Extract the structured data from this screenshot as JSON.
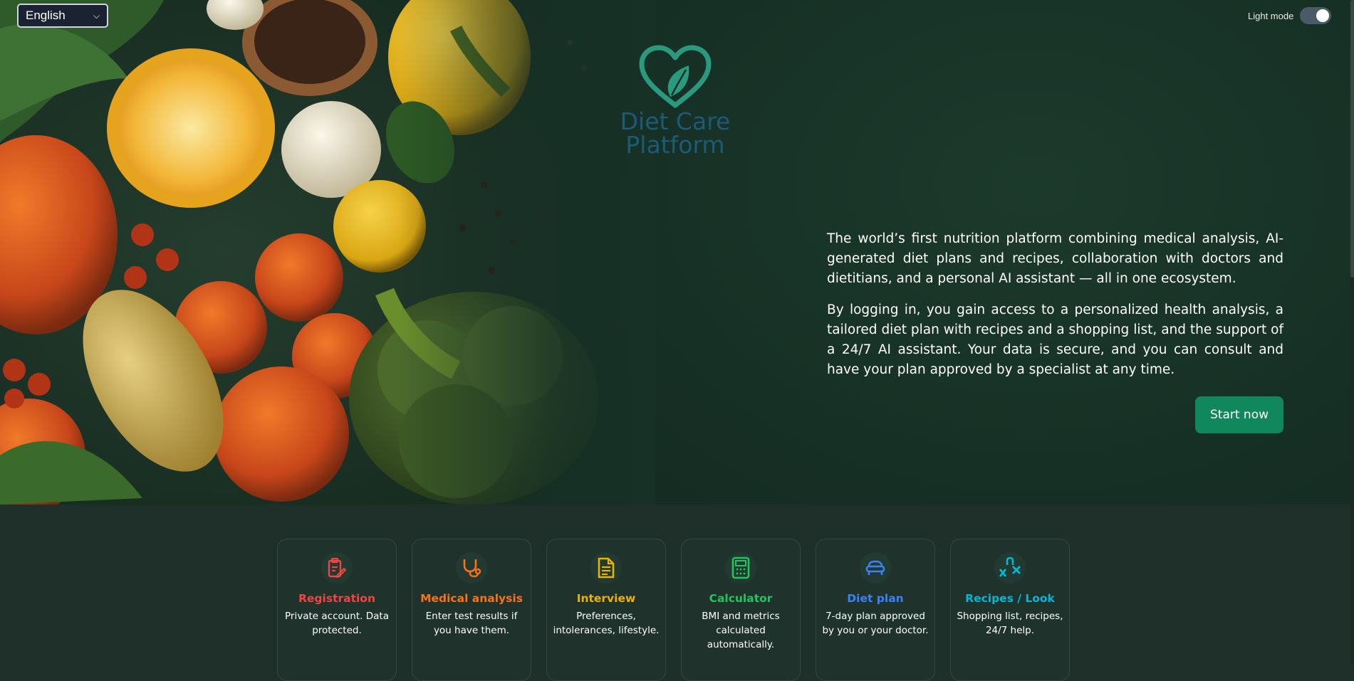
{
  "language_select": {
    "value": "English",
    "icon": "chevron-down-icon"
  },
  "theme_toggle": {
    "label": "Light mode",
    "checked": true
  },
  "logo": {
    "line1": "Diet Care",
    "line2": "Platform",
    "icon": "heart-leaf-icon",
    "colors": {
      "heart": "#2a9a7e",
      "text": "#1b5b78"
    }
  },
  "intro": {
    "paragraph1": "The world’s first nutrition platform combining medical analysis, AI-generated diet plans and recipes, collaboration with doctors and dietitians, and a personal AI assistant — all in one ecosystem.",
    "paragraph2": "By logging in, you gain access to a personalized health analysis, a tailored diet plan with recipes and a shopping list, and the support of a 24/7 AI assistant. Your data is secure, and you can consult and have your plan approved by a specialist at any time."
  },
  "cta": {
    "start_label": "Start now",
    "color": "#11875e"
  },
  "steps": [
    {
      "title": "Registration",
      "desc": "Private account. Data protected.",
      "color": "#ef4444",
      "icon": "clipboard-edit-icon"
    },
    {
      "title": "Medical analysis",
      "desc": "Enter test results if you have them.",
      "color": "#f97316",
      "icon": "stethoscope-icon"
    },
    {
      "title": "Interview",
      "desc": "Preferences, intolerances, lifestyle.",
      "color": "#eab308",
      "icon": "document-icon"
    },
    {
      "title": "Calculator",
      "desc": "BMI and metrics calculated automatically.",
      "color": "#22c55e",
      "icon": "calculator-icon"
    },
    {
      "title": "Diet plan",
      "desc": "7-day plan approved by you or your doctor.",
      "color": "#3b82f6",
      "icon": "bed-icon"
    },
    {
      "title": "Recipes / Look",
      "desc": "Shopping list, recipes, 24/7 help.",
      "color": "#06b6d4",
      "icon": "magnet-x-icon"
    }
  ]
}
